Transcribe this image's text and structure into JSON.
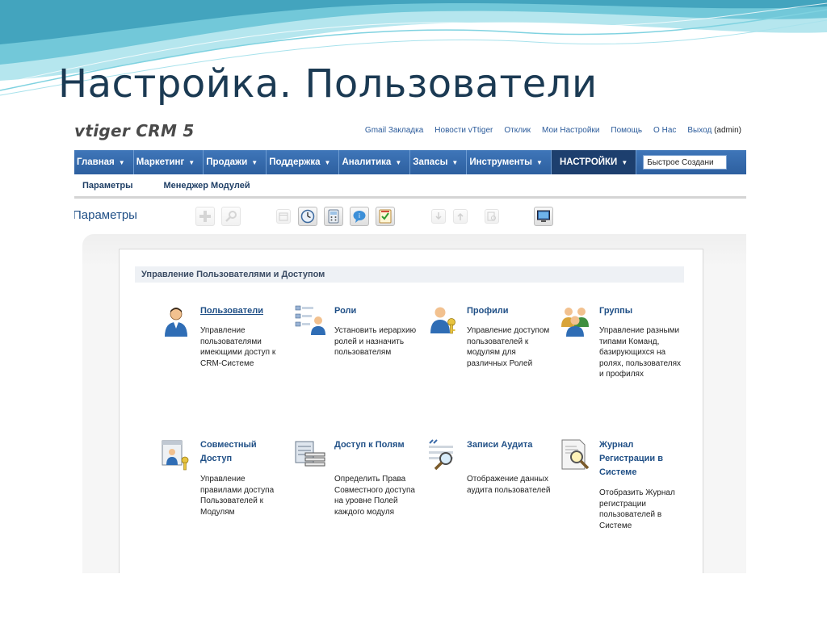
{
  "slide": {
    "title": "Настройка. Пользователи"
  },
  "colors": {
    "nav_bg": "#2d5f9f",
    "nav_active": "#1d3f6e",
    "link": "#2a5a9a",
    "title": "#1b3a53"
  },
  "header": {
    "logo": "vtiger CRM 5",
    "links": [
      "Gmail Закладка",
      "Новости vTtiger",
      "Отклик",
      "Мои Настройки",
      "Помощь",
      "О Нас",
      "Выход"
    ],
    "user": "(admin)"
  },
  "nav": {
    "tabs": [
      "Главная",
      "Маркетинг",
      "Продажи",
      "Поддержка",
      "Аналитика",
      "Запасы",
      "Инструменты",
      "НАСТРОЙКИ"
    ],
    "active_tab": "НАСТРОЙКИ",
    "quick_create": "Быстрое Создани"
  },
  "subnav": {
    "items": [
      "Параметры",
      "Менеджер Модулей"
    ]
  },
  "toolbar": {
    "label": "Параметры",
    "icons": [
      "add-icon",
      "search-icon",
      "calendar-icon",
      "clock-icon",
      "calculator-icon",
      "chat-icon",
      "vcard-icon",
      "import-icon",
      "export-icon",
      "find-duplicates-icon",
      "monitor-icon"
    ]
  },
  "section": {
    "title": "Управление Пользователями и Доступом",
    "modules": [
      {
        "title": "Пользователи",
        "desc": "Управление пользователями имеющими доступ к CRM-Системе",
        "icon": "user-icon"
      },
      {
        "title": "Роли",
        "desc": "Установить иерархию ролей и назначить пользователям",
        "icon": "roles-hierarchy-icon"
      },
      {
        "title": "Профили",
        "desc": "Управление доступом пользователей к модулям для различных Ролей",
        "icon": "profile-key-icon"
      },
      {
        "title": "Группы",
        "desc": "Управление разными типами Команд, базирующихся на ролях, пользователях и профилях",
        "icon": "groups-icon"
      },
      {
        "title": "Совместный Доступ",
        "desc": "Управление правилами доступа Пользователей к Модулям",
        "icon": "shared-access-icon"
      },
      {
        "title": "Доступ к Полям",
        "desc": "Определить Права Совместного доступа на уровне Полей каждого модуля",
        "icon": "field-access-icon"
      },
      {
        "title": "Записи Аудита",
        "desc": "Отображение данных аудита пользователей",
        "icon": "audit-trail-icon"
      },
      {
        "title": "Журнал Регистрации в Системе",
        "desc": "Отобразить Журнал регистрации пользователей в Системе",
        "icon": "login-history-icon"
      }
    ]
  }
}
